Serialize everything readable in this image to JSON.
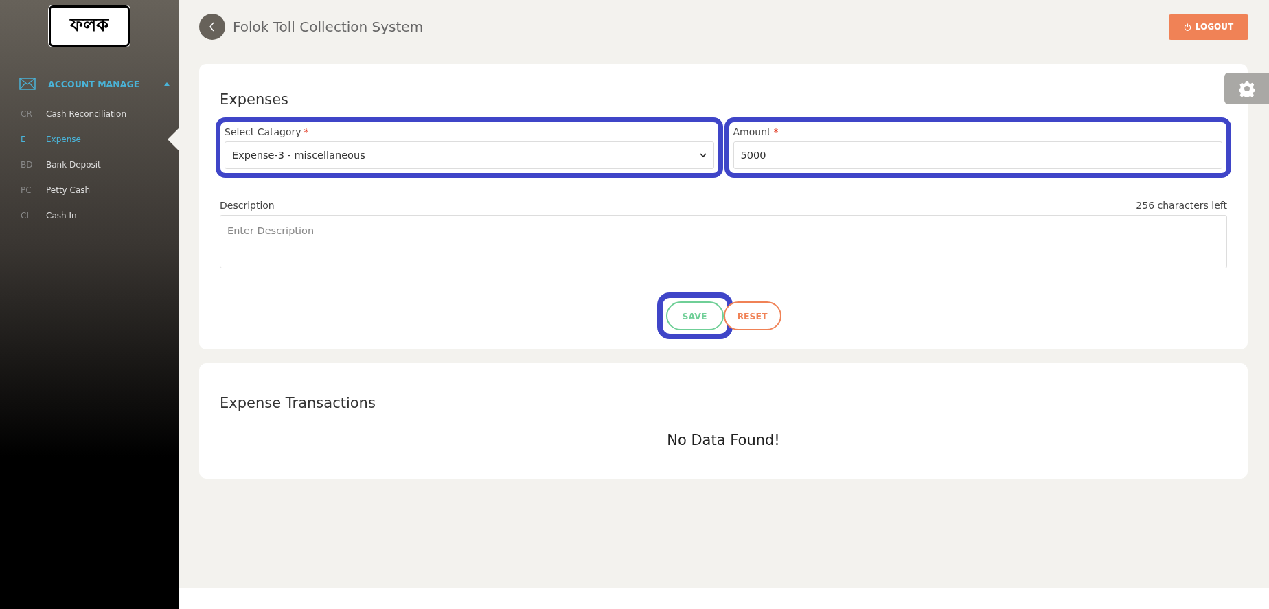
{
  "sidebar": {
    "logo": "ফলক",
    "section": {
      "label": "ACCOUNT MANAGE",
      "expanded": true
    },
    "items": [
      {
        "abbr": "CR",
        "label": "Cash Reconciliation",
        "selected": false
      },
      {
        "abbr": "E",
        "label": "Expense",
        "selected": true
      },
      {
        "abbr": "BD",
        "label": "Bank Deposit",
        "selected": false
      },
      {
        "abbr": "PC",
        "label": "Petty Cash",
        "selected": false
      },
      {
        "abbr": "CI",
        "label": "Cash In",
        "selected": false
      }
    ]
  },
  "header": {
    "title": "Folok Toll Collection System",
    "logout": "LOGOUT"
  },
  "form": {
    "title": "Expenses",
    "category": {
      "label": "Select Catagory",
      "required_mark": "*",
      "value": "Expense-3 - miscellaneous",
      "highlighted": true
    },
    "amount": {
      "label": "Amount",
      "required_mark": "*",
      "value": "5000",
      "highlighted": true
    },
    "description": {
      "label": "Description",
      "counter": "256 characters left",
      "placeholder": "Enter Description"
    },
    "buttons": [
      {
        "kind": "save",
        "label": "SAVE",
        "highlighted": true
      },
      {
        "kind": "reset",
        "label": "RESET",
        "highlighted": false
      }
    ]
  },
  "transactions": {
    "title": "Expense Transactions",
    "empty": "No Data Found!"
  }
}
